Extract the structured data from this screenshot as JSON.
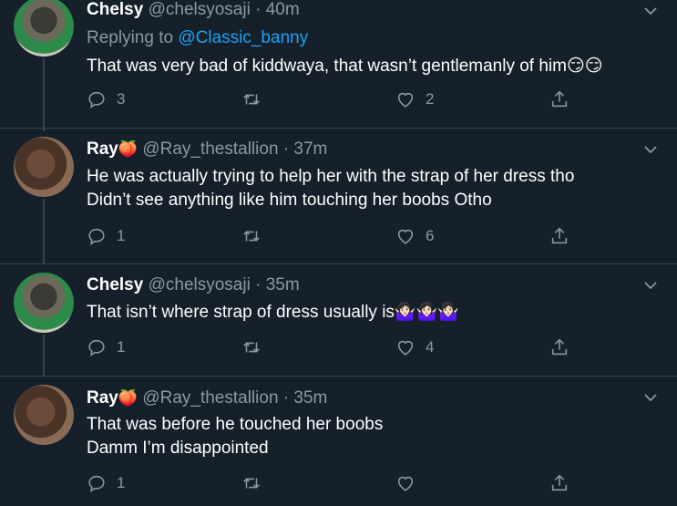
{
  "tweets": [
    {
      "name": "Chelsy",
      "handle": "@chelsyosaji",
      "time": "· 40m",
      "name_emoji": "",
      "replying_label": "Replying to",
      "replying_to": "@Classic_banny",
      "lines": [
        "That was very bad of kiddwaya, that wasn’t gentlemanly of him😏😏"
      ],
      "replies": "3",
      "retweets": "",
      "likes": "2"
    },
    {
      "name": "Ray",
      "handle": "@Ray_thestallion",
      "time": "· 37m",
      "name_emoji": "🍑",
      "lines": [
        "He was actually trying to help her with the strap of her dress tho",
        "Didn’t see anything like him touching her boobs Otho"
      ],
      "replies": "1",
      "retweets": "",
      "likes": "6"
    },
    {
      "name": "Chelsy",
      "handle": "@chelsyosaji",
      "time": "· 35m",
      "name_emoji": "",
      "lines": [
        "That isn’t where strap of dress usually is🤷🏻‍♀️🤷🏻‍♀️🤷🏻‍♀️"
      ],
      "replies": "1",
      "retweets": "",
      "likes": "4"
    },
    {
      "name": "Ray",
      "handle": "@Ray_thestallion",
      "time": "· 35m",
      "name_emoji": "🍑",
      "lines": [
        "That was before he touched her boobs",
        "Damm I’m disappointed"
      ],
      "replies": "1",
      "retweets": "",
      "likes": ""
    }
  ],
  "icons": {
    "reply": "reply-icon",
    "retweet": "retweet-icon",
    "like": "heart-icon",
    "share": "share-icon",
    "menu": "chevron-down-icon"
  },
  "colors": {
    "background": "#15202b",
    "secondary_text": "#8899a6",
    "link": "#1da1f2",
    "divider": "#38444d"
  }
}
